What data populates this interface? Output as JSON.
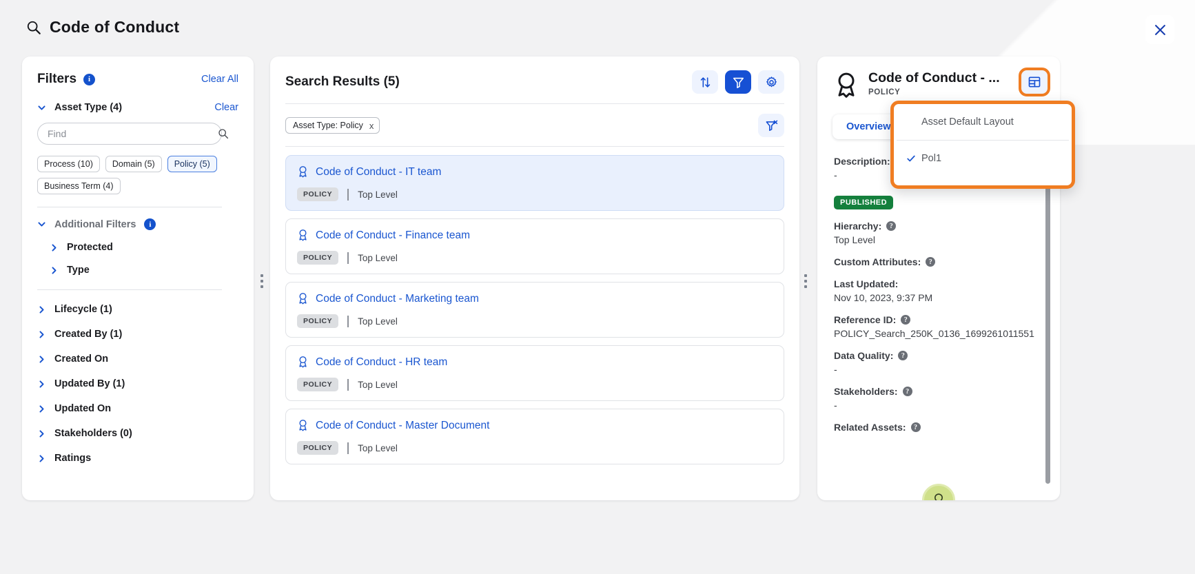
{
  "header": {
    "search_query": "Code of Conduct",
    "search_icon": "search-icon",
    "close_icon": "close-icon"
  },
  "filters": {
    "title": "Filters",
    "info_icon": "info-icon",
    "clear_all_label": "Clear All",
    "asset_type": {
      "label": "Asset Type (4)",
      "clear_label": "Clear",
      "find_placeholder": "Find",
      "find_value": "",
      "chips": [
        {
          "label": "Process (10)",
          "selected": false
        },
        {
          "label": "Domain (5)",
          "selected": false
        },
        {
          "label": "Policy (5)",
          "selected": true
        },
        {
          "label": "Business Term (4)",
          "selected": false
        }
      ]
    },
    "additional_filters": {
      "label": "Additional Filters",
      "info_icon": "info-icon",
      "items": [
        {
          "label": "Protected"
        },
        {
          "label": "Type"
        }
      ]
    },
    "groups": [
      {
        "label": "Lifecycle (1)"
      },
      {
        "label": "Created By (1)"
      },
      {
        "label": "Created On"
      },
      {
        "label": "Updated By (1)"
      },
      {
        "label": "Updated On"
      },
      {
        "label": "Stakeholders (0)"
      },
      {
        "label": "Ratings"
      }
    ]
  },
  "results": {
    "title": "Search Results (5)",
    "toolbar": [
      {
        "name": "sort-button",
        "icon": "sort-arrows-icon",
        "active": false
      },
      {
        "name": "filter-button",
        "icon": "filter-icon",
        "active": true
      },
      {
        "name": "settings-button",
        "icon": "gear-icon",
        "active": false
      }
    ],
    "clear_filter_icon": "filter-clear-icon",
    "facets": [
      {
        "label": "Asset Type: Policy",
        "remove_icon": "x"
      }
    ],
    "items": [
      {
        "title": "Code of Conduct - IT team",
        "type": "POLICY",
        "level": "Top Level",
        "selected": true
      },
      {
        "title": "Code of Conduct - Finance team",
        "type": "POLICY",
        "level": "Top Level",
        "selected": false
      },
      {
        "title": "Code of Conduct - Marketing team",
        "type": "POLICY",
        "level": "Top Level",
        "selected": false
      },
      {
        "title": "Code of Conduct - HR team",
        "type": "POLICY",
        "level": "Top Level",
        "selected": false
      },
      {
        "title": "Code of Conduct - Master Document",
        "type": "POLICY",
        "level": "Top Level",
        "selected": false
      }
    ]
  },
  "detail": {
    "title": "Code of Conduct - ...",
    "subtitle": "POLICY",
    "layout_icon": "layout-grid-icon",
    "tab_overview": "Overview",
    "status": "PUBLISHED",
    "fields": [
      {
        "key": "Description:",
        "value": "-",
        "help": false
      },
      {
        "key": "Hierarchy:",
        "value": "Top Level",
        "help": true
      },
      {
        "key": "Custom Attributes:",
        "value": "",
        "help": true
      },
      {
        "key": "Last Updated:",
        "value": "Nov 10, 2023, 9:37 PM",
        "help": false
      },
      {
        "key": "Reference ID:",
        "value": "POLICY_Search_250K_0136_1699261011551",
        "help": true
      },
      {
        "key": "Data Quality:",
        "value": "-",
        "help": true
      },
      {
        "key": "Stakeholders:",
        "value": "-",
        "help": true
      },
      {
        "key": "Related Assets:",
        "value": "",
        "help": true
      }
    ],
    "avatar_icon": "policy-ribbon-icon"
  },
  "layout_menu": {
    "items": [
      {
        "label": "Asset Default Layout",
        "checked": false
      },
      {
        "label": "Pol1",
        "checked": true
      }
    ]
  },
  "colors": {
    "accent_blue": "#1650d4",
    "link_blue": "#1a56d0",
    "highlight_orange": "#f07d22",
    "published_green": "#15803d",
    "selected_card": "#e9f0fd"
  }
}
